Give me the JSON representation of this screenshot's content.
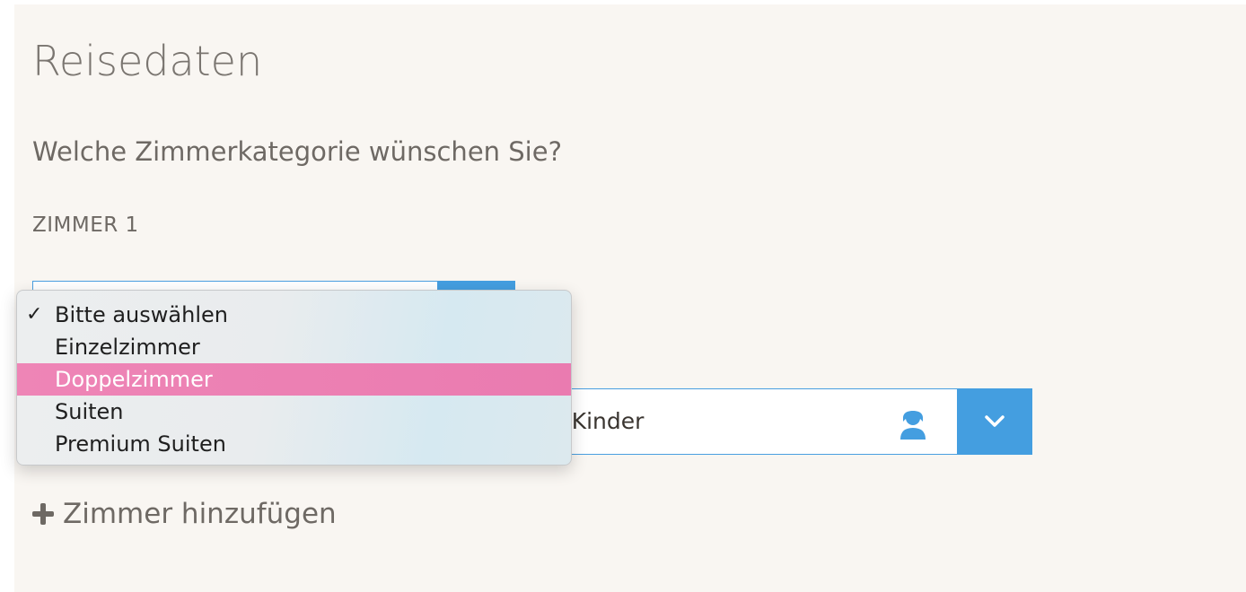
{
  "form": {
    "title": "Reisedaten",
    "question": "Welche Zimmerkategorie wünschen Sie?",
    "room_label": "ZIMMER 1",
    "room_category": {
      "selected": "Bitte auswählen",
      "highlighted": "Doppelzimmer",
      "options": [
        {
          "label": "Bitte auswählen",
          "checked": true
        },
        {
          "label": "Einzelzimmer",
          "checked": false
        },
        {
          "label": "Doppelzimmer",
          "checked": false,
          "highlighted": true
        },
        {
          "label": "Suiten",
          "checked": false
        },
        {
          "label": "Premium Suiten",
          "checked": false
        }
      ],
      "check_mark": "✓"
    },
    "guests": {
      "value_visible": ") Kinder",
      "icon": "person-icon"
    },
    "add_room_label": "Zimmer hinzufügen"
  },
  "colors": {
    "accent": "#449ee0",
    "highlight": "#ea7bb0",
    "panel_bg": "#f9f6f2",
    "text": "#6e6964"
  }
}
